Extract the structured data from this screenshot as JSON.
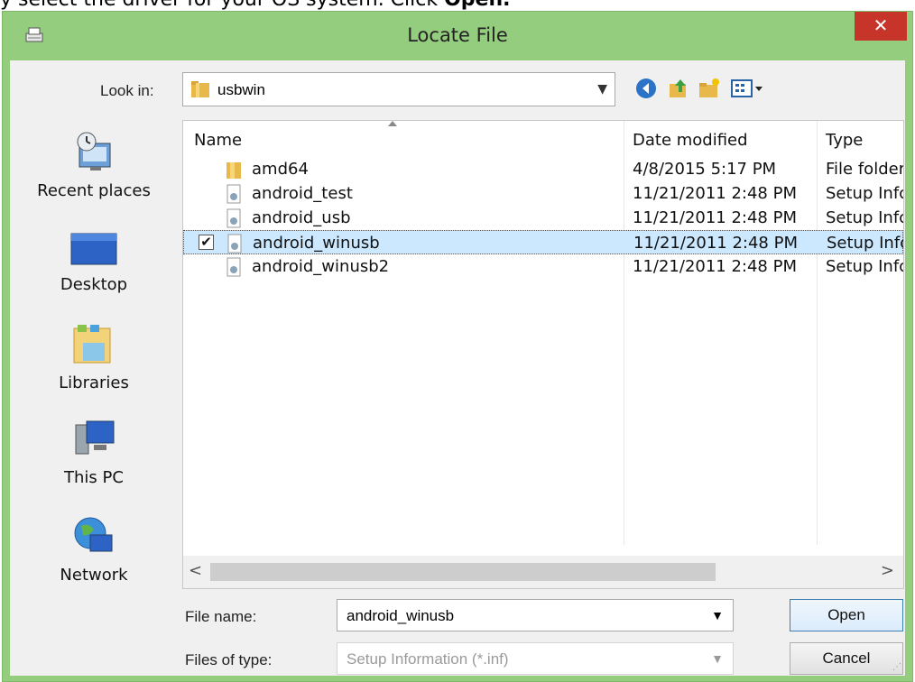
{
  "caption": {
    "text_before": "y select the driver for your OS system. Click ",
    "bold": "Open."
  },
  "window": {
    "title": "Locate File",
    "close_label": "✕"
  },
  "lookin": {
    "label": "Look in:",
    "value": "usbwin"
  },
  "places": [
    {
      "label": "Recent places",
      "icon": "recent-places-icon"
    },
    {
      "label": "Desktop",
      "icon": "desktop-icon"
    },
    {
      "label": "Libraries",
      "icon": "libraries-icon"
    },
    {
      "label": "This PC",
      "icon": "this-pc-icon"
    },
    {
      "label": "Network",
      "icon": "network-icon"
    }
  ],
  "columns": {
    "name": "Name",
    "date": "Date modified",
    "type": "Type"
  },
  "files": [
    {
      "name": "amd64",
      "date": "4/8/2015 5:17 PM",
      "type": "File folder",
      "icon": "folder-icon",
      "selected": false
    },
    {
      "name": "android_test",
      "date": "11/21/2011 2:48 PM",
      "type": "Setup Infc",
      "icon": "setup-info-file-icon",
      "selected": false
    },
    {
      "name": "android_usb",
      "date": "11/21/2011 2:48 PM",
      "type": "Setup Infc",
      "icon": "setup-info-file-icon",
      "selected": false
    },
    {
      "name": "android_winusb",
      "date": "11/21/2011 2:48 PM",
      "type": "Setup Infc",
      "icon": "setup-info-file-icon",
      "selected": true
    },
    {
      "name": "android_winusb2",
      "date": "11/21/2011 2:48 PM",
      "type": "Setup Infc",
      "icon": "setup-info-file-icon",
      "selected": false
    }
  ],
  "filename": {
    "label": "File name:",
    "value": "android_winusb"
  },
  "filetype": {
    "label": "Files of type:",
    "value": "Setup Information (*.inf)"
  },
  "buttons": {
    "open": "Open",
    "cancel": "Cancel"
  },
  "colors": {
    "frame": "#95cd7f",
    "close": "#c7352a",
    "selection": "#cce8ff"
  }
}
